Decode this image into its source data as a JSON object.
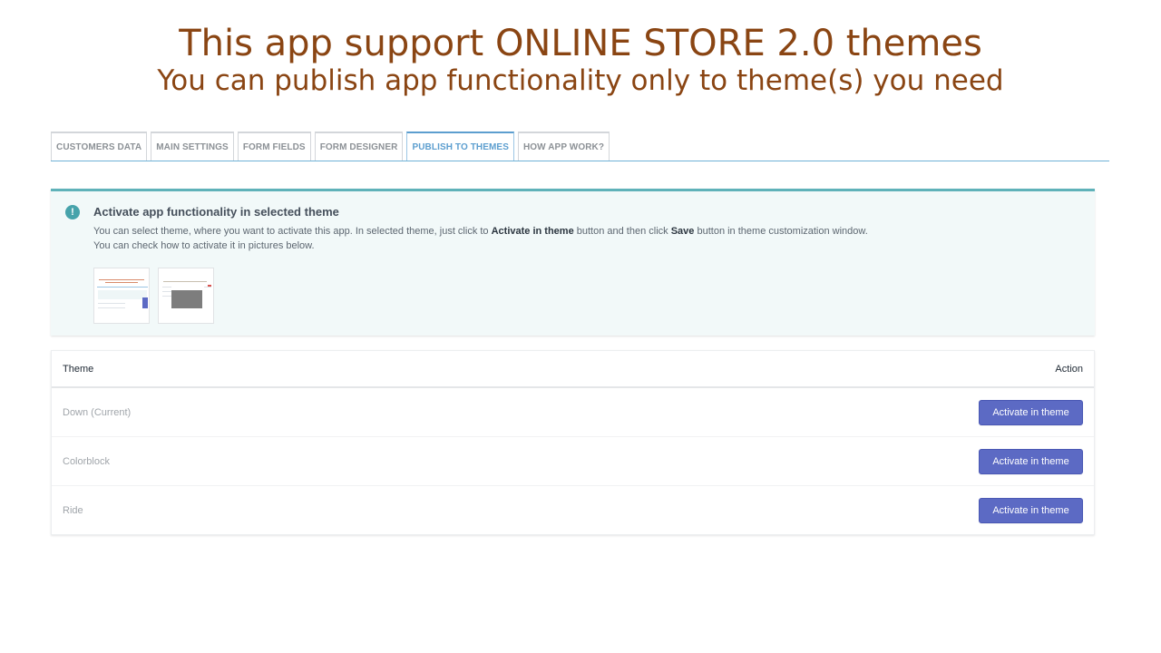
{
  "promo": {
    "title": "This app support ONLINE STORE 2.0 themes",
    "subtitle": "You can publish app functionality only to theme(s) you need"
  },
  "tabs": [
    {
      "label": "CUSTOMERS DATA",
      "active": false
    },
    {
      "label": "MAIN SETTINGS",
      "active": false
    },
    {
      "label": "FORM FIELDS",
      "active": false
    },
    {
      "label": "FORM DESIGNER",
      "active": false
    },
    {
      "label": "PUBLISH TO THEMES",
      "active": true
    },
    {
      "label": "HOW APP WORK?",
      "active": false
    }
  ],
  "banner": {
    "icon": "info-exclamation-icon",
    "icon_glyph": "!",
    "title": "Activate app functionality in selected theme",
    "line1_a": "You can select theme, where you want to activate this app. In selected theme, just click to ",
    "line1_b": "Activate in theme",
    "line1_c": " button and then click ",
    "line1_d": "Save",
    "line1_e": " button in theme customization window.",
    "line2": "You can check how to activate it in pictures below."
  },
  "table": {
    "header_theme": "Theme",
    "header_action": "Action",
    "rows": [
      {
        "theme": "Down (Current)",
        "action": "Activate in theme"
      },
      {
        "theme": "Colorblock",
        "action": "Activate in theme"
      },
      {
        "theme": "Ride",
        "action": "Activate in theme"
      }
    ]
  },
  "colors": {
    "promo_text": "#8a4513",
    "active_tab": "#5c9ecf",
    "banner_bg": "#f2f9f9",
    "banner_accent": "#5fb2b9",
    "primary_button": "#5c6ac4"
  }
}
